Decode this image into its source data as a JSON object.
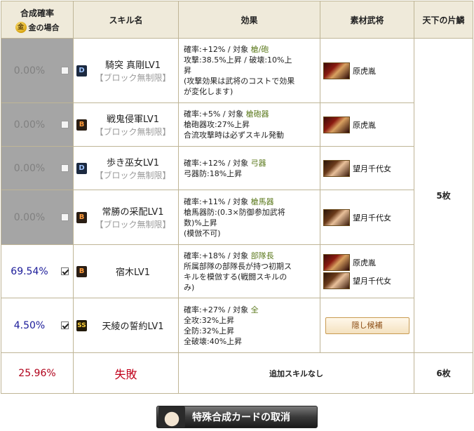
{
  "header": {
    "rate_title": "合成確率",
    "rate_sub": "金の場合",
    "rate_icon": "gold-coin-icon",
    "skill_name": "スキル名",
    "effect": "効果",
    "material": "素材武将",
    "shards": "天下の片鱗"
  },
  "rows": [
    {
      "rate": "0.00%",
      "enabled": false,
      "checked": false,
      "badge": "D",
      "name": "騎突 真剛LV1",
      "sub": "【ブロック無制限】",
      "effect": {
        "prefix": "確率:+12%  /  対象 ",
        "target": "槍/砲",
        "lines": [
          "攻撃:38.5%上昇 / 破壊:10%上",
          "昇",
          "(攻撃効果は武将のコストで効果",
          "が変化します)"
        ]
      },
      "materials": [
        {
          "portrait": "red",
          "name": "原虎胤"
        }
      ],
      "button": ""
    },
    {
      "rate": "0.00%",
      "enabled": false,
      "checked": false,
      "badge": "B",
      "name": "戦鬼侵軍LV1",
      "sub": "【ブロック無制限】",
      "effect": {
        "prefix": "確率:+5%  /  対象 ",
        "target": "槍砲器",
        "lines": [
          "槍砲器攻:27%上昇",
          "合流攻撃時は必ずスキル発動"
        ]
      },
      "materials": [
        {
          "portrait": "red",
          "name": "原虎胤"
        }
      ],
      "button": ""
    },
    {
      "rate": "0.00%",
      "enabled": false,
      "checked": false,
      "badge": "D",
      "name": "歩き巫女LV1",
      "sub": "【ブロック無制限】",
      "effect": {
        "prefix": "確率:+12%  /  対象 ",
        "target": "弓器",
        "lines": [
          "弓器防:18%上昇"
        ]
      },
      "materials": [
        {
          "portrait": "girl",
          "name": "望月千代女"
        }
      ],
      "button": ""
    },
    {
      "rate": "0.00%",
      "enabled": false,
      "checked": false,
      "badge": "B",
      "name": "常勝の采配LV1",
      "sub": "【ブロック無制限】",
      "effect": {
        "prefix": "確率:+11%  /  対象 ",
        "target": "槍馬器",
        "lines": [
          "槍馬器防:(0.3×防御参加武将",
          "数)%上昇",
          "(模倣不可)"
        ]
      },
      "materials": [
        {
          "portrait": "girl",
          "name": "望月千代女"
        }
      ],
      "button": ""
    },
    {
      "rate": "69.54%",
      "enabled": true,
      "checked": true,
      "badge": "B",
      "name": "宿木LV1",
      "sub": "",
      "effect": {
        "prefix": "確率:+18%  /  対象 ",
        "target": "部隊長",
        "lines": [
          "所属部隊の部隊長が持つ初期ス",
          "キルを模倣する(戦闘スキルの",
          "み)"
        ]
      },
      "materials": [
        {
          "portrait": "red",
          "name": "原虎胤"
        },
        {
          "portrait": "girl",
          "name": "望月千代女"
        }
      ],
      "button": ""
    },
    {
      "rate": "4.50%",
      "enabled": true,
      "checked": true,
      "badge": "SS",
      "name": "天綾の誓約LV1",
      "sub": "",
      "effect": {
        "prefix": "確率:+27%  /  対象 ",
        "target": "全",
        "lines": [
          "全攻:32%上昇",
          "全防:32%上昇",
          "全破壊:40%上昇"
        ]
      },
      "materials": [],
      "button": "隠し候補"
    }
  ],
  "shards_main": "5枚",
  "failure": {
    "rate": "25.96%",
    "label": "失敗",
    "note": "追加スキルなし",
    "shards": "6枚"
  },
  "cancel_button": "特殊合成カードの取消"
}
